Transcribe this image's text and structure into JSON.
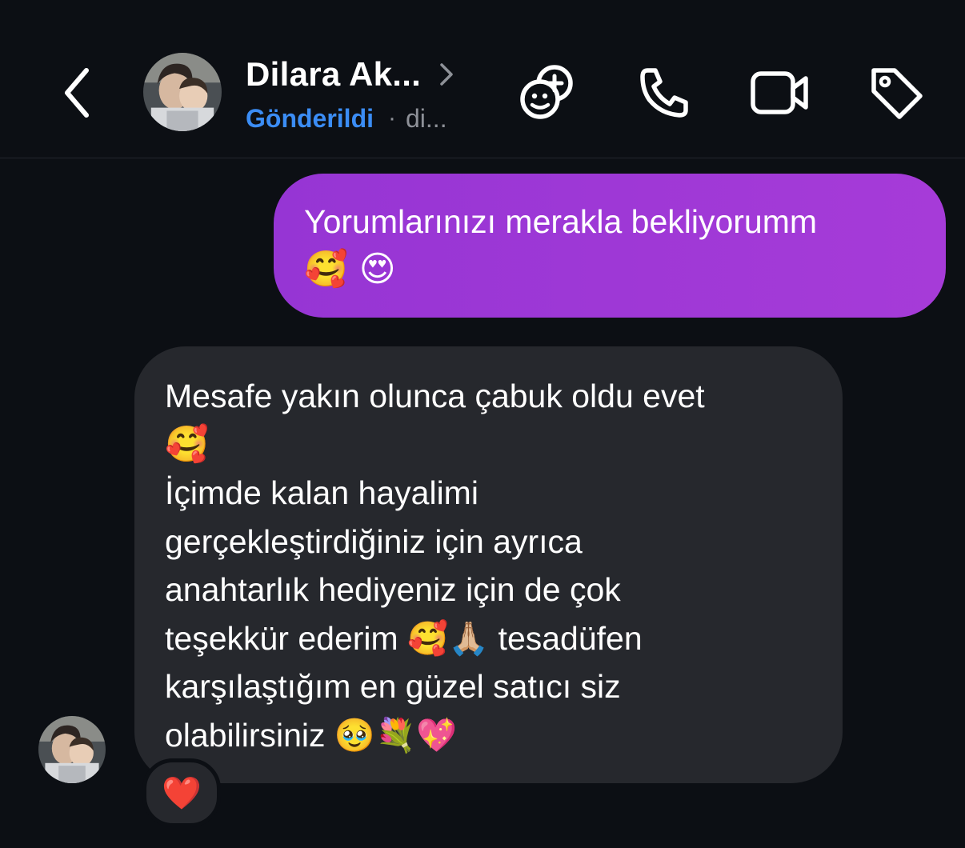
{
  "header": {
    "contact_name": "Dilara Ak...",
    "status": "Gönderildi",
    "separator": "·",
    "time_truncated": "di...",
    "icons": {
      "back": "chevron-left-icon",
      "profile_chevron": "chevron-right-icon",
      "effects": "add-face-icon",
      "call": "phone-icon",
      "video": "video-camera-icon",
      "label": "tag-icon"
    }
  },
  "messages": {
    "outgoing": {
      "line1": "Yorumlarınızı merakla bekliyorumm",
      "line2": "🥰 😍"
    },
    "incoming": {
      "lines": [
        "Mesafe yakın olunca çabuk oldu evet",
        "🥰",
        "İçimde kalan hayalimi",
        "gerçekleştirdiğiniz için ayrıca",
        "anahtarlık hediyeniz için de çok",
        "teşekkür ederim 🥰🙏🏼 tesadüfen",
        "karşılaştığım en güzel satıcı siz",
        "olabilirsiniz 🥹💐💖"
      ],
      "reaction": "❤️"
    }
  },
  "colors": {
    "background": "#0c0f14",
    "outgoing_bubble": "#9a36d6",
    "incoming_bubble": "#26282d",
    "status_blue": "#3b8df5",
    "muted_text": "#8e9198"
  }
}
